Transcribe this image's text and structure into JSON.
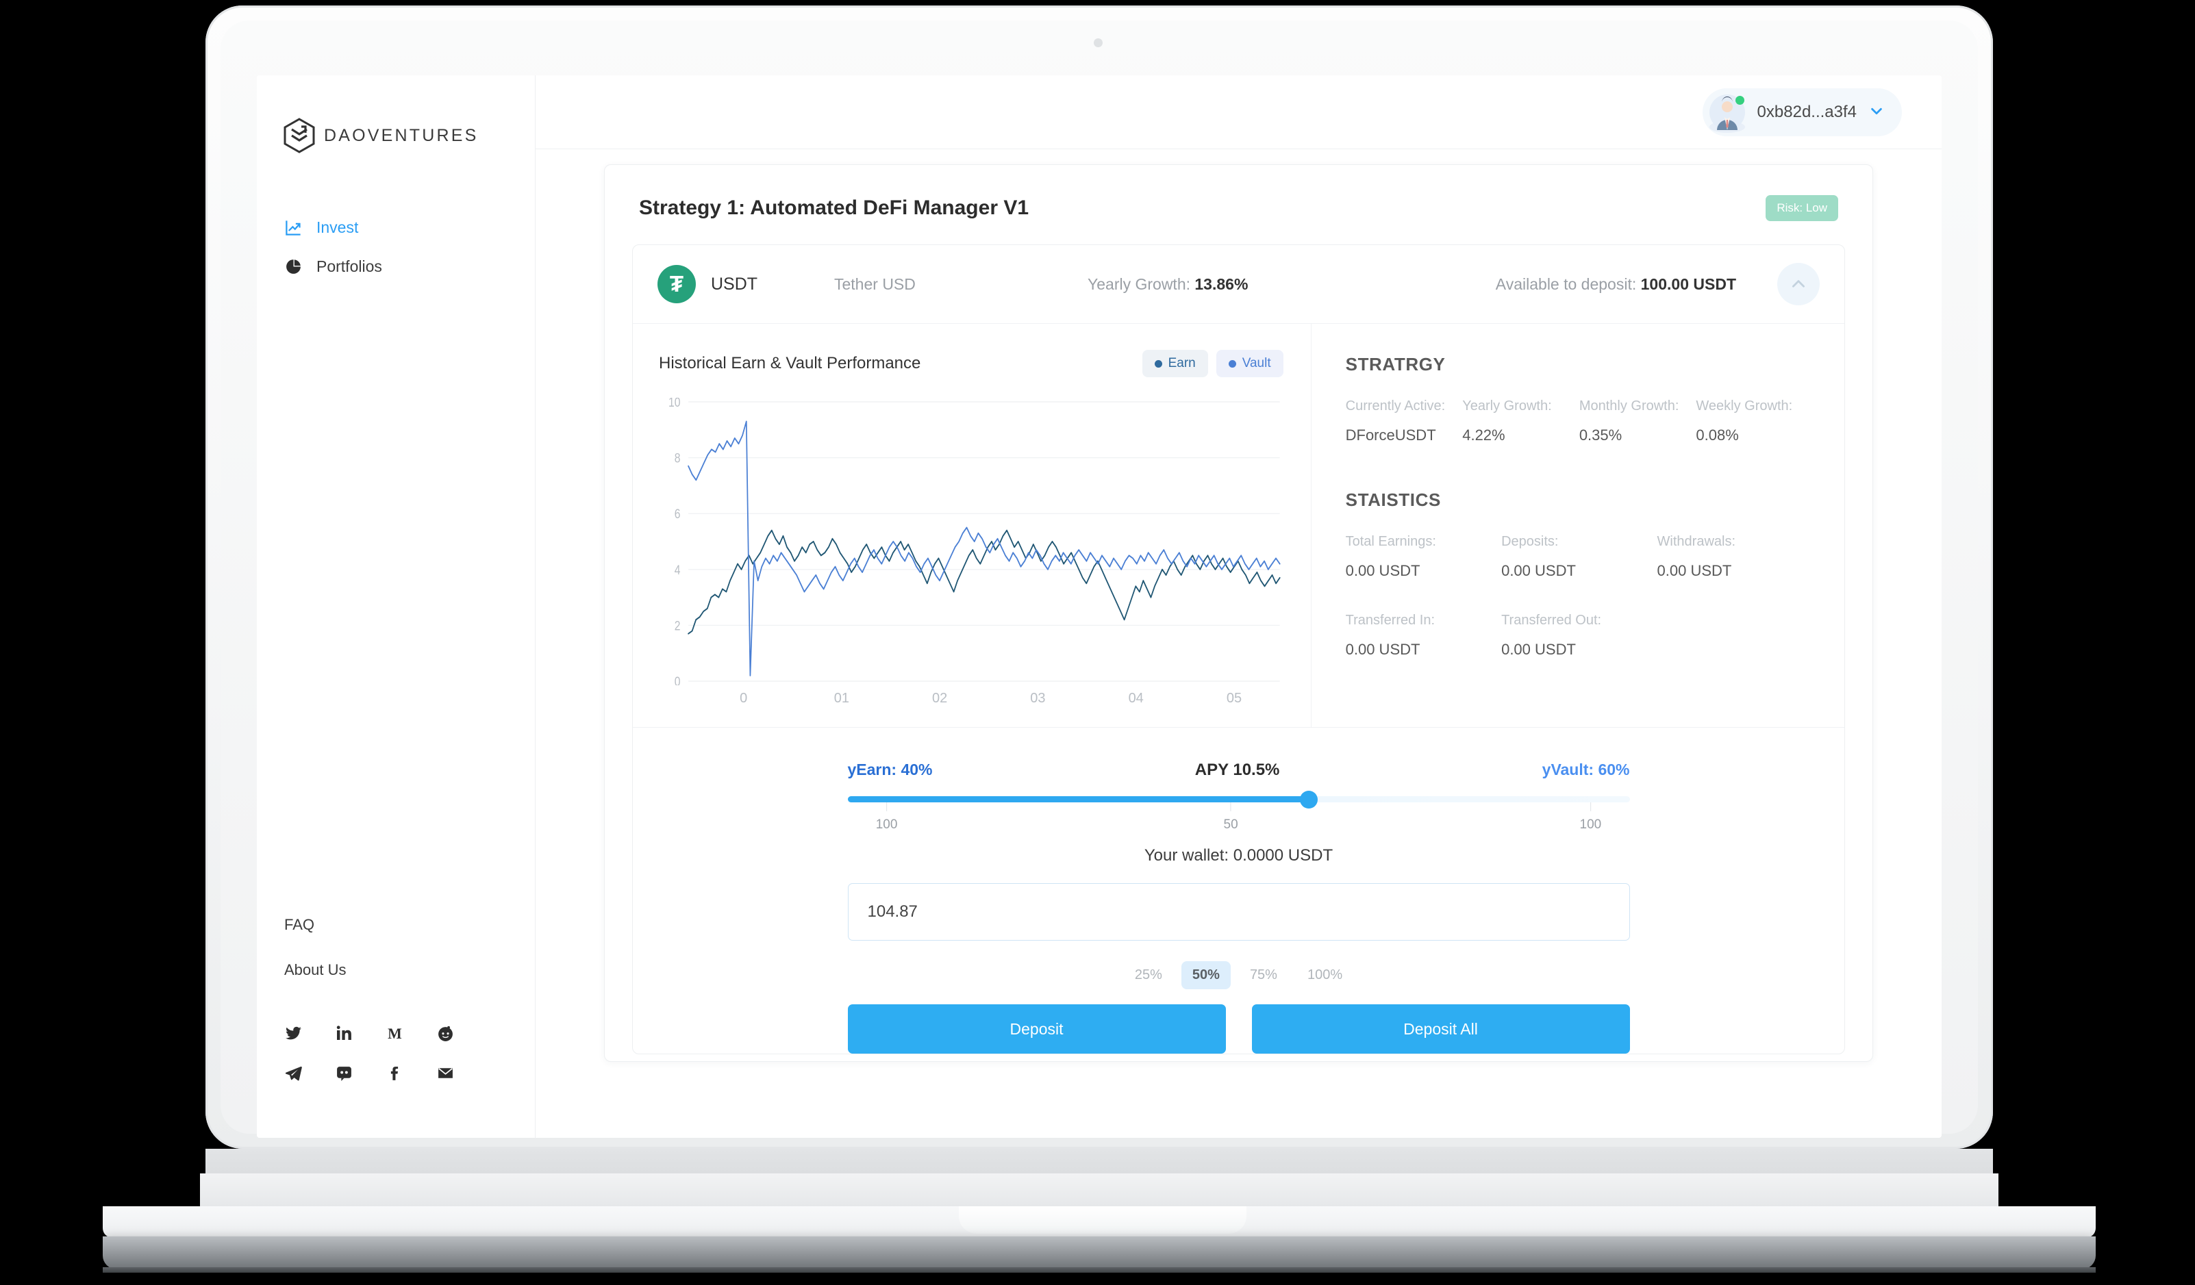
{
  "sidebar": {
    "logo_text": "DAOVENTURES",
    "logo_icon": "daoventures-hex-logo",
    "nav": [
      {
        "label": "Invest",
        "icon": "trending-up-icon",
        "active": true
      },
      {
        "label": "Portfolios",
        "icon": "pie-chart-icon",
        "active": false
      }
    ],
    "footer_links": [
      {
        "label": "FAQ"
      },
      {
        "label": "About Us"
      }
    ],
    "socials_row1": [
      "twitter-icon",
      "linkedin-icon",
      "medium-icon",
      "reddit-icon"
    ],
    "socials_row2": [
      "telegram-icon",
      "discord-icon",
      "facebook-icon",
      "email-icon"
    ]
  },
  "topbar": {
    "wallet_address": "0xb82d...a3f4",
    "avatar_icon": "user-avatar",
    "status_icon": "online-dot",
    "chevron_icon": "chevron-down-icon"
  },
  "strategy": {
    "title": "Strategy 1: Automated DeFi Manager V1",
    "risk_badge": "Risk: Low"
  },
  "token": {
    "icon": "tether-usdt-icon",
    "glyph": "₮",
    "symbol": "USDT",
    "name": "Tether USD",
    "growth_label": "Yearly Growth:",
    "growth_value": "13.86%",
    "available_label": "Available to deposit:",
    "available_value": "100.00 USDT",
    "collapse_icon": "chevron-up-icon"
  },
  "chart_panel": {
    "title": "Historical Earn & Vault Performance",
    "legend": [
      {
        "label": "Earn",
        "color": "#2f6a9e"
      },
      {
        "label": "Vault",
        "color": "#4a7fd4"
      }
    ]
  },
  "chart_data": {
    "type": "line",
    "title": "Historical Earn & Vault Performance",
    "xlabel": "",
    "ylabel": "",
    "ylim": [
      0,
      10
    ],
    "yticks": [
      0,
      2,
      4,
      6,
      8,
      10
    ],
    "xticks": [
      "0",
      "01",
      "02",
      "03",
      "04",
      "05"
    ],
    "grid": true,
    "legend_position": "top-right",
    "series": [
      {
        "name": "Earn",
        "color": "#1f5673",
        "values": [
          1.7,
          1.8,
          2.2,
          2.3,
          2.5,
          2.6,
          3.0,
          3.1,
          3.0,
          3.3,
          3.2,
          3.6,
          3.9,
          4.2,
          4.0,
          4.3,
          4.5,
          4.2,
          4.4,
          4.6,
          4.9,
          5.2,
          5.4,
          5.1,
          4.9,
          5.2,
          4.8,
          4.6,
          4.3,
          4.5,
          4.8,
          4.6,
          4.9,
          5.0,
          4.7,
          4.5,
          4.6,
          4.8,
          5.1,
          4.9,
          4.6,
          4.4,
          4.2,
          3.9,
          4.1,
          4.4,
          4.7,
          4.9,
          4.6,
          4.4,
          4.6,
          4.8,
          4.5,
          4.3,
          4.6,
          4.8,
          5.0,
          4.7,
          4.9,
          4.6,
          4.3,
          4.1,
          3.8,
          3.5,
          3.9,
          4.2,
          4.4,
          4.1,
          3.8,
          3.5,
          3.2,
          3.6,
          3.9,
          4.2,
          4.5,
          4.7,
          4.4,
          4.2,
          4.5,
          4.8,
          5.0,
          4.7,
          4.9,
          5.2,
          5.4,
          5.1,
          4.8,
          5.0,
          4.7,
          4.4,
          4.6,
          4.9,
          4.6,
          4.3,
          4.5,
          4.8,
          5.0,
          4.8,
          4.5,
          4.2,
          4.4,
          4.6,
          4.3,
          4.0,
          3.7,
          3.5,
          3.8,
          4.1,
          4.3,
          4.0,
          3.7,
          3.4,
          3.1,
          2.8,
          2.5,
          2.2,
          2.6,
          3.0,
          3.4,
          3.2,
          3.6,
          3.3,
          3.0,
          3.4,
          3.7,
          4.0,
          3.8,
          4.1,
          4.3,
          4.0,
          3.8,
          4.1,
          4.3,
          4.5,
          4.2,
          4.0,
          4.3,
          4.5,
          4.2,
          4.0,
          4.2,
          4.4,
          4.1,
          3.9,
          4.1,
          4.3,
          4.0,
          3.8,
          3.5,
          3.7,
          3.9,
          3.6,
          3.4,
          3.6,
          3.8,
          3.5,
          3.7
        ]
      },
      {
        "name": "Vault",
        "color": "#4a7fd4",
        "values": [
          7.7,
          7.4,
          7.2,
          7.5,
          7.8,
          8.1,
          8.3,
          8.2,
          8.5,
          8.3,
          8.6,
          8.4,
          8.7,
          8.5,
          8.8,
          9.3,
          0.2,
          4.3,
          3.6,
          4.1,
          4.4,
          4.2,
          4.5,
          4.3,
          4.6,
          4.4,
          4.2,
          4.0,
          3.8,
          3.5,
          3.2,
          3.4,
          3.6,
          3.8,
          3.5,
          3.3,
          3.6,
          3.9,
          4.1,
          3.8,
          3.6,
          3.9,
          4.2,
          4.4,
          4.1,
          3.9,
          4.2,
          4.5,
          4.7,
          4.4,
          4.2,
          4.5,
          4.8,
          5.0,
          4.8,
          4.5,
          4.3,
          4.6,
          4.4,
          4.1,
          3.9,
          4.2,
          4.4,
          4.1,
          3.8,
          3.6,
          3.9,
          4.2,
          4.5,
          4.8,
          5.0,
          5.3,
          5.5,
          5.2,
          5.0,
          5.3,
          5.1,
          4.8,
          4.6,
          4.9,
          5.1,
          4.8,
          4.5,
          4.3,
          4.6,
          4.4,
          4.1,
          4.3,
          4.6,
          4.4,
          4.7,
          4.5,
          4.2,
          4.0,
          4.3,
          4.5,
          4.3,
          4.6,
          4.4,
          4.2,
          4.5,
          4.7,
          4.5,
          4.3,
          4.6,
          4.4,
          4.2,
          4.5,
          4.3,
          4.1,
          4.4,
          4.2,
          4.0,
          4.3,
          4.5,
          4.4,
          4.2,
          4.5,
          4.3,
          4.6,
          4.4,
          4.2,
          4.5,
          4.7,
          4.4,
          4.2,
          4.4,
          4.6,
          4.3,
          4.1,
          4.4,
          4.2,
          4.5,
          4.3,
          4.1,
          4.3,
          4.5,
          4.2,
          4.0,
          4.2,
          4.4,
          4.1,
          4.3,
          4.5,
          4.2,
          4.0,
          4.2,
          4.4,
          4.1,
          4.3,
          4.0,
          4.2,
          4.4,
          4.2
        ]
      }
    ]
  },
  "strategy_stats": {
    "heading": "STRATRGY",
    "cells": [
      {
        "label": "Currently Active:",
        "value": "DForceUSDT"
      },
      {
        "label": "Yearly Growth:",
        "value": "4.22%"
      },
      {
        "label": "Monthly Growth:",
        "value": "0.35%"
      },
      {
        "label": "Weekly Growth:",
        "value": "0.08%"
      }
    ]
  },
  "statistics": {
    "heading": "STAISTICS",
    "row1": [
      {
        "label": "Total Earnings:",
        "value": "0.00 USDT"
      },
      {
        "label": "Deposits:",
        "value": "0.00 USDT"
      },
      {
        "label": "Withdrawals:",
        "value": "0.00 USDT"
      }
    ],
    "row2": [
      {
        "label": "Transferred In:",
        "value": "0.00 USDT"
      },
      {
        "label": "Transferred Out:",
        "value": "0.00 USDT"
      },
      {
        "label": "",
        "value": ""
      }
    ]
  },
  "allocation": {
    "earn_label": "yEarn: 40%",
    "apy_label": "APY 10.5%",
    "vault_label": "yVault: 60%",
    "slider_percent": 59,
    "ticks": [
      {
        "text": "100",
        "pos": 5
      },
      {
        "text": "50",
        "pos": 49
      },
      {
        "text": "100",
        "pos": 95
      }
    ]
  },
  "deposit": {
    "wallet_line": "Your wallet: 0.0000 USDT",
    "amount_value": "104.87",
    "amount_placeholder": "0.00",
    "percents": [
      {
        "label": "25%",
        "selected": false
      },
      {
        "label": "50%",
        "selected": true
      },
      {
        "label": "75%",
        "selected": false
      },
      {
        "label": "100%",
        "selected": false
      }
    ],
    "deposit_button": "Deposit",
    "deposit_all_button": "Deposit All"
  },
  "colors": {
    "accent": "#2eadf2",
    "tether_green": "#26a17b",
    "risk_green": "#9edcc6",
    "earn_line": "#1f5673",
    "vault_line": "#4a7fd4"
  }
}
